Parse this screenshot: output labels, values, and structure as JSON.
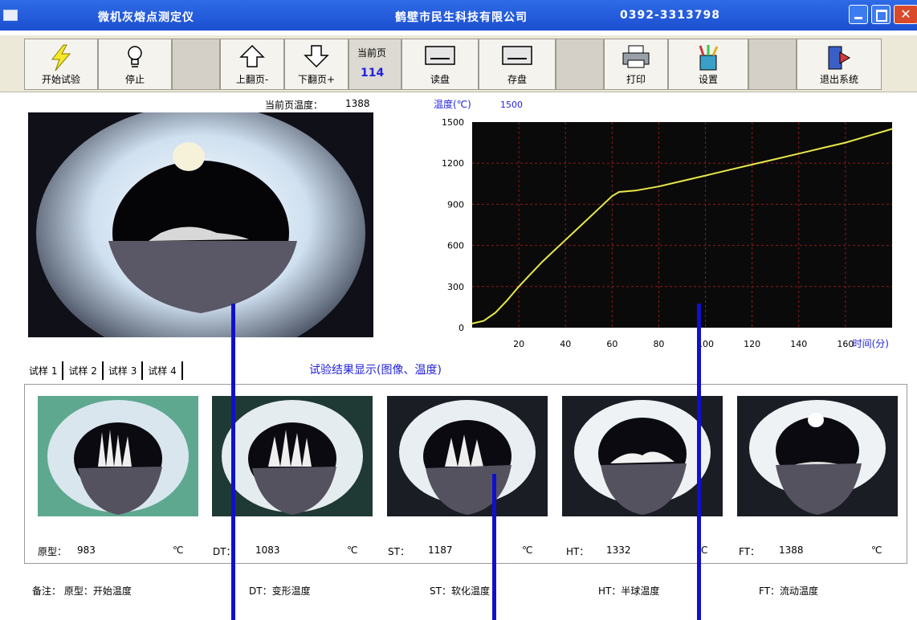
{
  "window": {
    "title": "微机灰熔点测定仪",
    "company": "鹤壁市民生科技有限公司",
    "phone": "0392-3313798"
  },
  "toolbar": {
    "start": "开始试验",
    "stop": "停止",
    "page_up": "上翻页-",
    "page_down": "下翻页+",
    "current_page_label": "当前页",
    "current_page_value": "114",
    "read_disk": "读盘",
    "save_disk": "存盘",
    "print": "打印",
    "settings": "设置",
    "exit": "退出系统"
  },
  "status": {
    "current_temp_label": "当前页温度：",
    "current_temp_value": "1388"
  },
  "chart_data": {
    "type": "line",
    "ylabel": "温度(℃)",
    "ymax_label": "1500",
    "xlabel": "时间(分)",
    "ylim": [
      0,
      1500
    ],
    "xlim": [
      0,
      180
    ],
    "yticks": [
      0,
      300,
      600,
      900,
      1200,
      1500
    ],
    "xticks": [
      20,
      40,
      60,
      80,
      100,
      120,
      140,
      160
    ],
    "grid": true,
    "line_color": "#e8e84a",
    "background": "#0b0a0a",
    "grid_color": "#8b1a1a",
    "x": [
      0,
      5,
      10,
      15,
      20,
      25,
      30,
      35,
      40,
      45,
      50,
      55,
      60,
      63,
      70,
      80,
      90,
      100,
      110,
      120,
      130,
      140,
      150,
      160,
      170,
      180
    ],
    "y": [
      30,
      50,
      110,
      200,
      300,
      390,
      480,
      560,
      640,
      720,
      800,
      880,
      960,
      990,
      1000,
      1030,
      1070,
      1110,
      1150,
      1190,
      1230,
      1270,
      1310,
      1350,
      1400,
      1450
    ]
  },
  "tabs": [
    "试样 1",
    "试样 2",
    "试样 3",
    "试样 4"
  ],
  "results_title": "试验结果显示(图像、温度)",
  "results": [
    {
      "label": "原型：",
      "value": "983",
      "unit": "℃"
    },
    {
      "label": "DT：",
      "value": "1083",
      "unit": "℃"
    },
    {
      "label": "ST：",
      "value": "1187",
      "unit": "℃"
    },
    {
      "label": "HT：",
      "value": "1332",
      "unit": "℃"
    },
    {
      "label": "FT：",
      "value": "1388",
      "unit": "℃"
    }
  ],
  "notes": [
    "备注：  原型：开始温度",
    "DT：变形温度",
    "ST：软化温度",
    "HT：半球温度",
    "FT：流动温度"
  ],
  "colors": {
    "title_bar": "#1b4fd1",
    "accent_blue": "#1010cc",
    "page_value_blue": "#2222dd"
  }
}
